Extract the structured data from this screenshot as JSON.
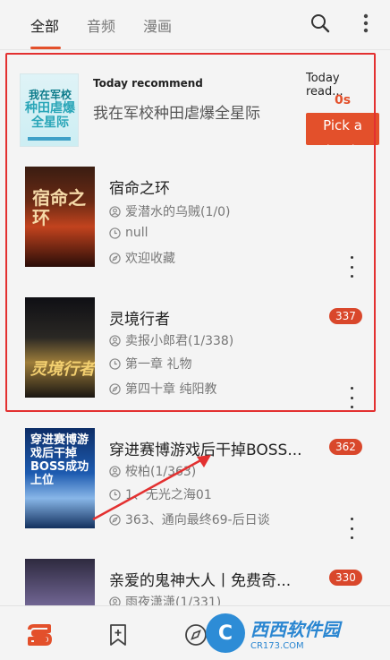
{
  "header": {
    "tabs": [
      {
        "label": "全部"
      },
      {
        "label": "音频"
      },
      {
        "label": "漫画"
      }
    ],
    "search_icon": "search-icon",
    "more_icon": "more-vert-icon"
  },
  "recommend": {
    "cover_text_top": "我在军校",
    "cover_text_mid": "种田虐爆全星际",
    "label": "Today recommend",
    "title": "我在军校种田虐爆全星际",
    "today_read_label": "Today read...",
    "today_read_value": "0s",
    "pick_button": "Pick a book"
  },
  "books": [
    {
      "cover_text": "宿命之环",
      "title": "宿命之环",
      "author": "爱潜水的乌贼(1/0)",
      "progress": "null",
      "latest": "欢迎收藏",
      "badge": ""
    },
    {
      "cover_text": "灵境行者",
      "title": "灵境行者",
      "author": "卖报小郎君(1/338)",
      "progress": "第一章 礼物",
      "latest": "第四十章 纯阳教",
      "badge": "337"
    },
    {
      "cover_text": "穿进赛博游戏后干掉BOSS成功上位",
      "title": "穿进赛博游戏后干掉BOSS...",
      "author": "桉柏(1/363)",
      "progress": "1、无光之海01",
      "latest": "363、通向最终69-后日谈",
      "badge": "362"
    },
    {
      "cover_text": "",
      "title": "亲爱的鬼神大人丨免费奇...",
      "author": "雨夜潇潇(1/331)",
      "progress": "",
      "latest": "",
      "badge": "330"
    }
  ],
  "bottom_nav": {
    "items": [
      "bookshelf-icon",
      "bookmark-add-icon",
      "explore-icon"
    ]
  },
  "watermark": {
    "logo": "C",
    "name": "西西软件园",
    "url": "CR173.COM"
  },
  "colors": {
    "accent": "#e3502b",
    "badge": "#d9472b",
    "highlight": "#e33030"
  }
}
